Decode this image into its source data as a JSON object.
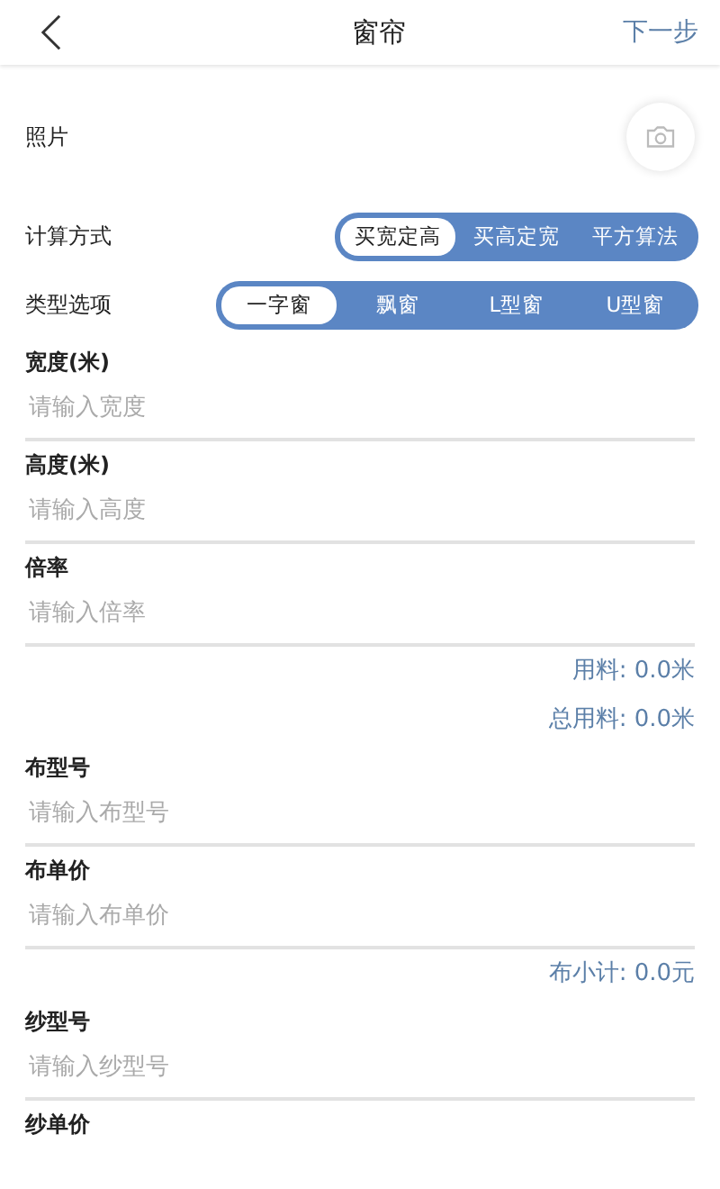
{
  "header": {
    "title": "窗帘",
    "next": "下一步"
  },
  "photo": {
    "label": "照片"
  },
  "segments": [
    {
      "label": "计算方式",
      "options": [
        {
          "label": "买宽定高",
          "selected": true
        },
        {
          "label": "买高定宽",
          "selected": false
        },
        {
          "label": "平方算法",
          "selected": false
        }
      ]
    },
    {
      "label": "类型选项",
      "options": [
        {
          "label": "一字窗",
          "selected": true
        },
        {
          "label": "飘窗",
          "selected": false
        },
        {
          "label": "L型窗",
          "selected": false
        },
        {
          "label": "U型窗",
          "selected": false
        }
      ]
    }
  ],
  "items": [
    {
      "kind": "field",
      "label": "宽度(米)",
      "placeholder": "请输入宽度"
    },
    {
      "kind": "field",
      "label": "高度(米)",
      "placeholder": "请输入高度"
    },
    {
      "kind": "field",
      "label": "倍率",
      "placeholder": "请输入倍率"
    },
    {
      "kind": "total",
      "text": "用料: 0.0米"
    },
    {
      "kind": "total",
      "text": "总用料: 0.0米"
    },
    {
      "kind": "field",
      "label": "布型号",
      "placeholder": "请输入布型号"
    },
    {
      "kind": "field",
      "label": "布单价",
      "placeholder": "请输入布单价"
    },
    {
      "kind": "total",
      "text": "布小计: 0.0元"
    },
    {
      "kind": "field",
      "label": "纱型号",
      "placeholder": "请输入纱型号"
    },
    {
      "kind": "label",
      "label": "纱单价"
    }
  ]
}
